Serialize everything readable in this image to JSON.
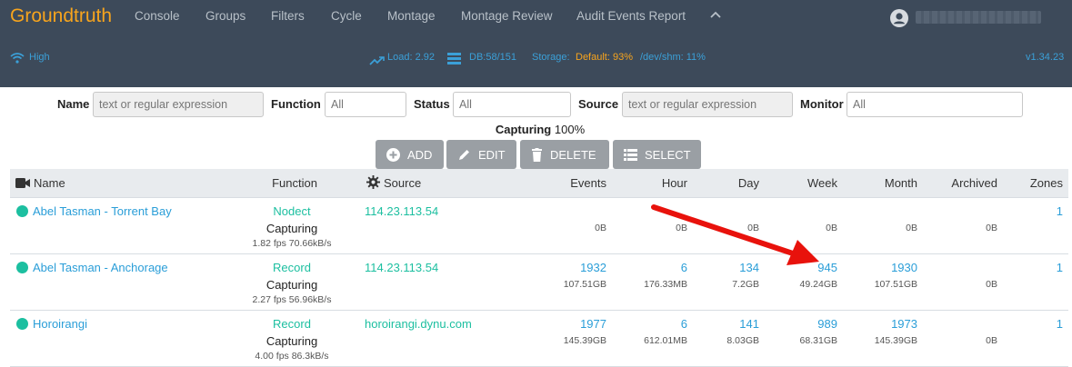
{
  "app": {
    "brand": "Groundtruth"
  },
  "nav": {
    "items": [
      "Console",
      "Groups",
      "Filters",
      "Cycle",
      "Montage",
      "Montage Review",
      "Audit Events Report"
    ]
  },
  "status": {
    "signal": "High",
    "load": "Load: 2.92",
    "db": "DB:58/151",
    "storage_label": "Storage:",
    "storage_default": "Default: 93%",
    "storage_shm": "/dev/shm: 11%",
    "version": "v1.34.23"
  },
  "filters": {
    "name_label": "Name",
    "name_placeholder": "text or regular expression",
    "function_label": "Function",
    "function_placeholder": "All",
    "status_label": "Status",
    "status_placeholder": "All",
    "source_label": "Source",
    "source_placeholder": "text or regular expression",
    "monitor_label": "Monitor",
    "monitor_placeholder": "All"
  },
  "capturing": {
    "label": "Capturing",
    "value": "100%"
  },
  "toolbar": {
    "add": "ADD",
    "edit": "EDIT",
    "delete": "DELETE",
    "select": "SELECT"
  },
  "table": {
    "headers": {
      "name": "Name",
      "function": "Function",
      "source": "Source",
      "events": "Events",
      "hour": "Hour",
      "day": "Day",
      "week": "Week",
      "month": "Month",
      "archived": "Archived",
      "zones": "Zones"
    },
    "rows": [
      {
        "name": "Abel Tasman - Torrent Bay",
        "function": "Nodect",
        "capturing": "Capturing",
        "fps": "1.82 fps 70.66kB/s",
        "source": "114.23.113.54",
        "events": "",
        "events_size": "0B",
        "hour": "",
        "hour_size": "0B",
        "day": "",
        "day_size": "0B",
        "week": "",
        "week_size": "0B",
        "month": "",
        "month_size": "0B",
        "archived_size": "0B",
        "zones": "1"
      },
      {
        "name": "Abel Tasman - Anchorage",
        "function": "Record",
        "capturing": "Capturing",
        "fps": "2.27 fps 56.96kB/s",
        "source": "114.23.113.54",
        "events": "1932",
        "events_size": "107.51GB",
        "hour": "6",
        "hour_size": "176.33MB",
        "day": "134",
        "day_size": "7.2GB",
        "week": "945",
        "week_size": "49.24GB",
        "month": "1930",
        "month_size": "107.51GB",
        "archived_size": "0B",
        "zones": "1"
      },
      {
        "name": "Horoirangi",
        "function": "Record",
        "capturing": "Capturing",
        "fps": "4.00 fps 86.3kB/s",
        "source": "horoirangi.dynu.com",
        "events": "1977",
        "events_size": "145.39GB",
        "hour": "6",
        "hour_size": "612.01MB",
        "day": "141",
        "day_size": "8.03GB",
        "week": "989",
        "week_size": "68.31GB",
        "month": "1973",
        "month_size": "145.39GB",
        "archived_size": "0B",
        "zones": "1"
      }
    ]
  },
  "colors": {
    "brand": "#f7a41d",
    "header_bg": "#3d4a5a",
    "link": "#2a9ed8",
    "status_ok": "#1cbfa0",
    "annotation_arrow": "#e8120c"
  }
}
